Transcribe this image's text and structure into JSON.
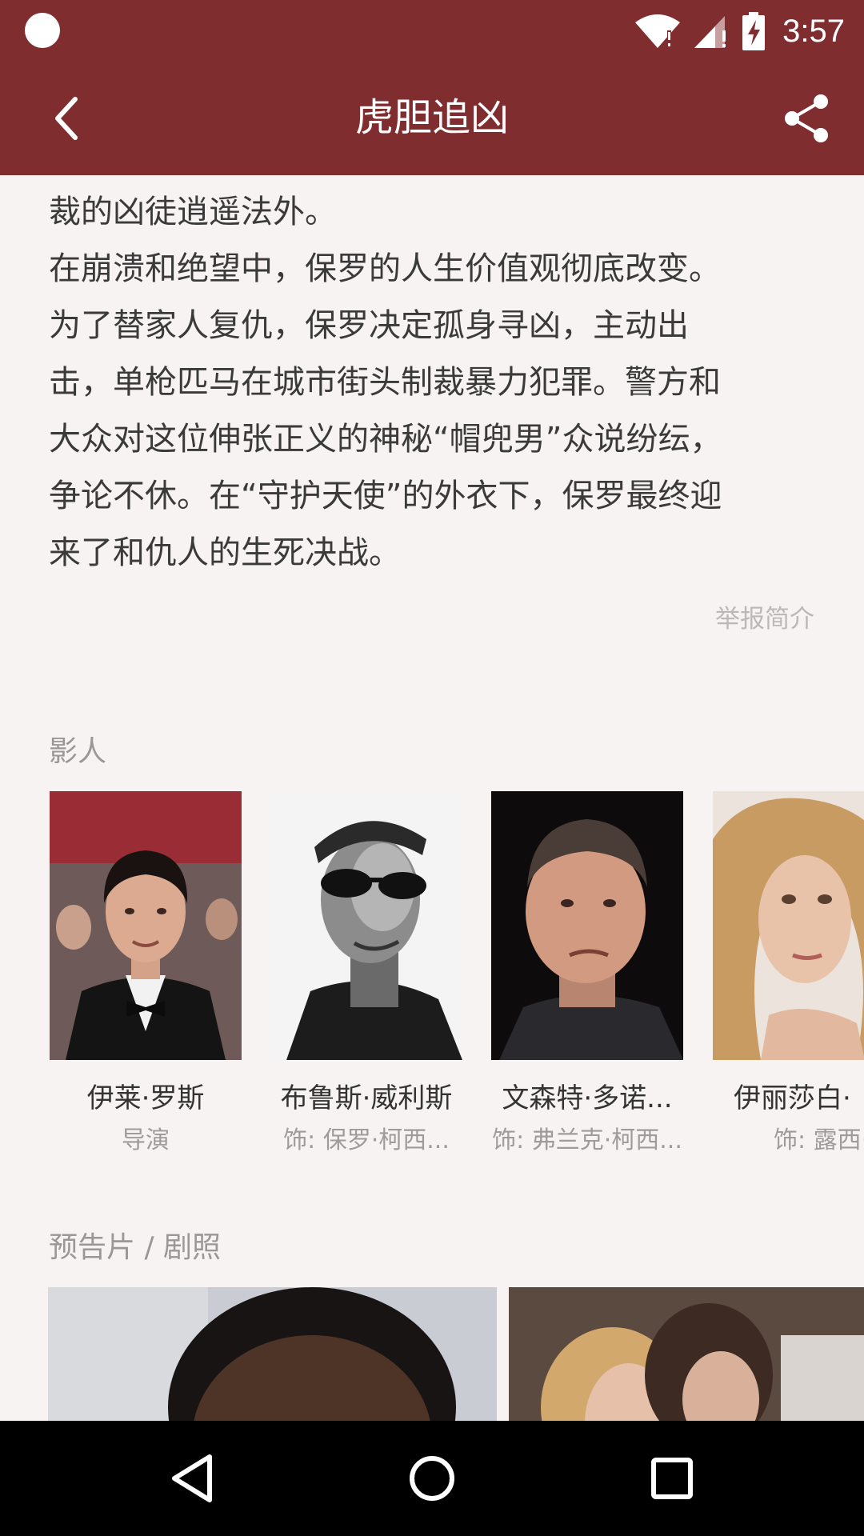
{
  "status_bar": {
    "time": "3:57",
    "icons": [
      "notification-dot-icon",
      "wifi-alert-icon",
      "signal-alert-icon",
      "battery-charging-icon"
    ]
  },
  "app_bar": {
    "title": "虎胆追凶",
    "back_icon": "back-arrow-icon",
    "share_icon": "share-icon"
  },
  "synopsis": {
    "lines": [
      "裁的凶徒逍遥法外。",
      "在崩溃和绝望中，保罗的人生价值观彻底改变。",
      "为了替家人复仇，保罗决定孤身寻凶，主动出",
      "击，单枪匹马在城市街头制裁暴力犯罪。警方和",
      "大众对这位伸张正义的神秘“帽兜男”众说纷纭，",
      "争论不休。在“守护天使”的外衣下，保罗最终迎",
      "来了和仇人的生死决战。"
    ],
    "report_link": "举报简介"
  },
  "cast": {
    "label": "影人",
    "members": [
      {
        "name": "伊莱·罗斯",
        "role": "导演"
      },
      {
        "name": "布鲁斯·威利斯",
        "role": "饰: 保罗·柯西..."
      },
      {
        "name": "文森特·多诺...",
        "role": "饰: 弗兰克·柯西..."
      },
      {
        "name": "伊丽莎白·",
        "role": "饰: 露西·柯西"
      }
    ]
  },
  "media": {
    "label": "预告片 / 剧照"
  },
  "colors": {
    "primary": "#802d30",
    "background": "#f6f3f2"
  },
  "nav": {
    "icons": [
      "nav-back-icon",
      "nav-home-icon",
      "nav-recents-icon"
    ]
  }
}
